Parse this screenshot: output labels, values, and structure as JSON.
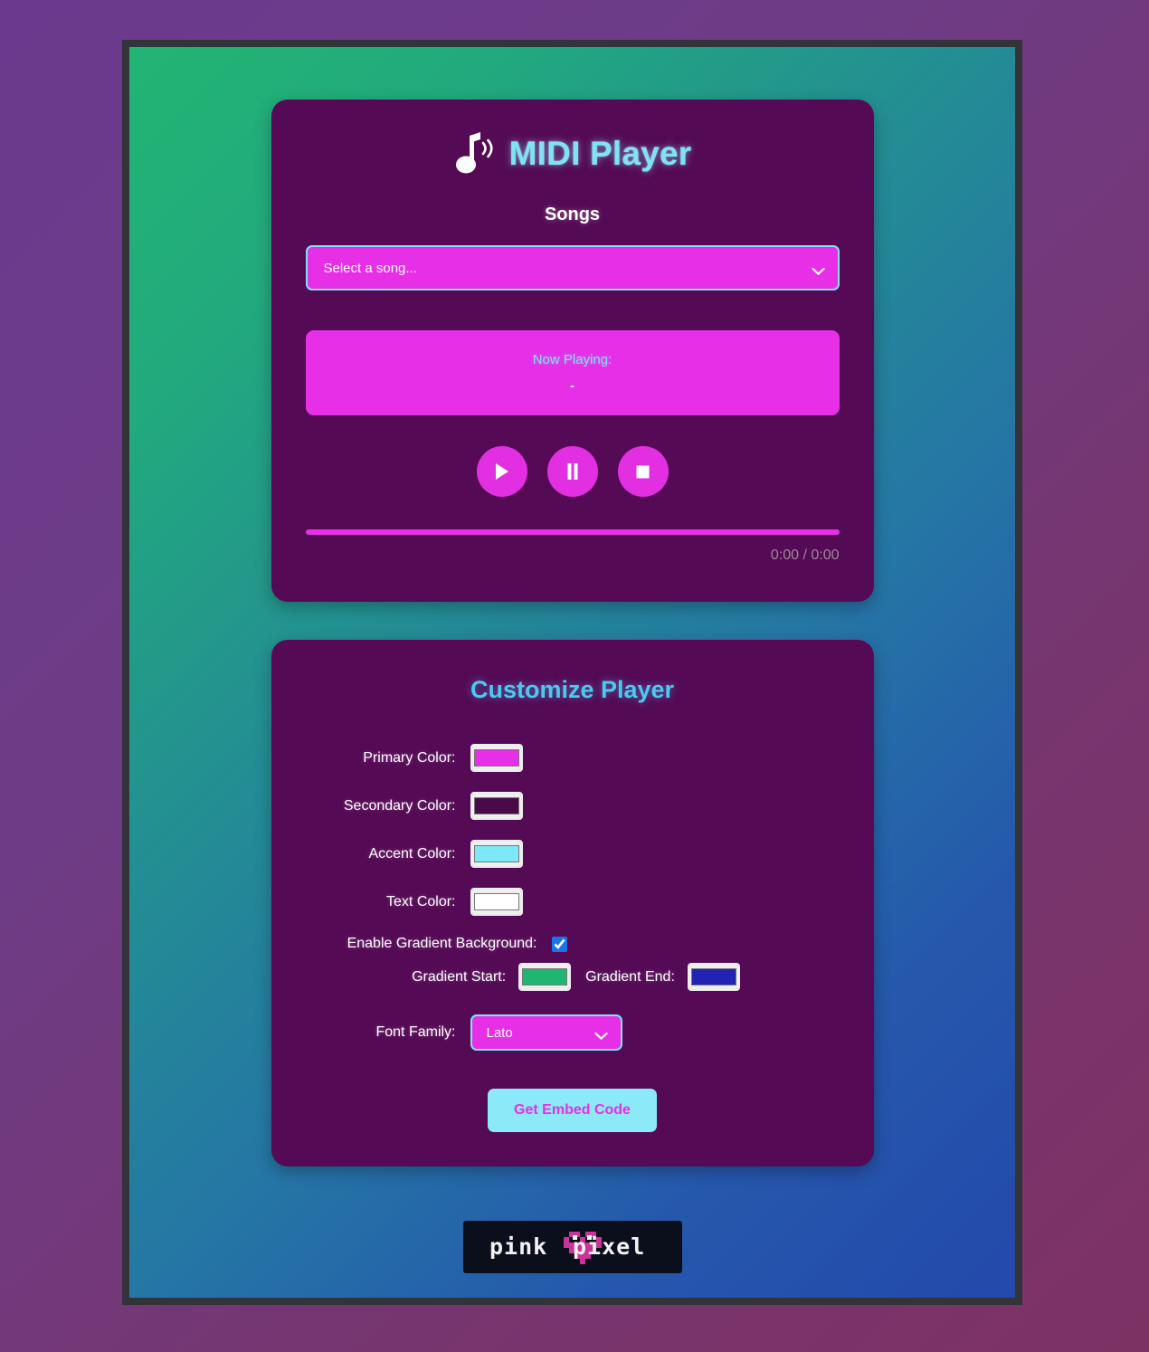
{
  "app": {
    "title": "MIDI Player",
    "note_icon": "music-note-icon"
  },
  "player": {
    "songs_label": "Songs",
    "song_select": {
      "selected": "Select a song...",
      "placeholder": "Select a song...",
      "options": [
        "Select a song..."
      ]
    },
    "now_playing_label": "Now Playing:",
    "now_playing_track": "-",
    "controls": [
      {
        "name": "play-button",
        "icon": "play-icon",
        "label": "Play"
      },
      {
        "name": "pause-button",
        "icon": "pause-icon",
        "label": "Pause"
      },
      {
        "name": "stop-button",
        "icon": "stop-icon",
        "label": "Stop"
      }
    ],
    "progress_percent": 0,
    "time_display": "0:00 / 0:00",
    "current_time": "0:00",
    "total_time": "0:00"
  },
  "customize": {
    "title": "Customize Player",
    "fields": [
      {
        "label": "Primary Color:",
        "value": "#e72fe7",
        "name": "primary-color"
      },
      {
        "label": "Secondary Color:",
        "value": "#4a0a4a",
        "name": "secondary-color"
      },
      {
        "label": "Accent Color:",
        "value": "#7de8f7",
        "name": "accent-color"
      },
      {
        "label": "Text Color:",
        "value": "#ffffff",
        "name": "text-color"
      }
    ],
    "gradient_toggle_label": "Enable Gradient Background:",
    "gradient_enabled": true,
    "gradient_start_label": "Gradient Start:",
    "gradient_start_value": "#21b573",
    "gradient_end_label": "Gradient End:",
    "gradient_end_value": "#2222b5",
    "font_family_label": "Font Family:",
    "font_family_value": "Lato",
    "font_family_options": [
      "Lato"
    ],
    "embed_button_label": "Get Embed Code"
  },
  "footer": {
    "logo_text": "pinkpixel",
    "logo_text_left": "pink",
    "logo_text_right": "pixel",
    "heart_color": "#cc3399",
    "logo_background": "#0b0f1c"
  },
  "theme": {
    "card_background": "#550a55",
    "accent_cyan": "#7fe3f5",
    "primary_magenta": "#e72fe7",
    "page_background": "#6b3a8e",
    "frame_color": "#32343a",
    "gradient_start": "#21b573",
    "gradient_end": "#2449ab"
  }
}
